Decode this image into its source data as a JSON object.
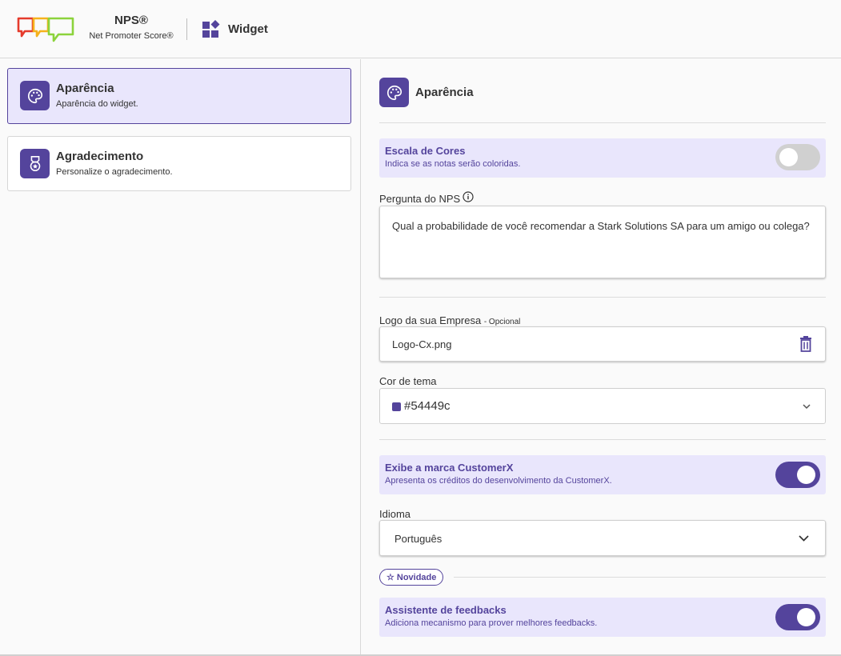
{
  "header": {
    "brand_title": "NPS®",
    "brand_subtitle": "Net Promoter Score®",
    "section_label": "Widget"
  },
  "sidebar": {
    "items": [
      {
        "title": "Aparência",
        "subtitle": "Aparência do widget.",
        "icon": "palette-icon",
        "active": true
      },
      {
        "title": "Agradecimento",
        "subtitle": "Personalize o agradecimento.",
        "icon": "medal-icon",
        "active": false
      }
    ]
  },
  "main": {
    "section_title": "Aparência",
    "color_scale": {
      "title": "Escala de Cores",
      "subtitle": "Indica se as notas serão coloridas.",
      "enabled": false
    },
    "question": {
      "label": "Pergunta do NPS",
      "value": "Qual a probabilidade de você recomendar a Stark Solutions SA para um amigo ou colega?"
    },
    "logo": {
      "label": "Logo da sua Empresa",
      "optional": "- Opcional",
      "value": "Logo-Cx.png"
    },
    "theme_color": {
      "label": "Cor de tema",
      "value": "#54449c"
    },
    "branding": {
      "title": "Exibe a marca CustomerX",
      "subtitle": "Apresenta os créditos do desenvolvimento da CustomerX.",
      "enabled": true
    },
    "language": {
      "label": "Idioma",
      "value": "Português"
    },
    "badge": {
      "label": "Novidade"
    },
    "assistant": {
      "title": "Assistente de feedbacks",
      "subtitle": "Adiciona mecanismo para prover melhores feedbacks.",
      "enabled": true
    }
  },
  "colors": {
    "accent": "#54449c",
    "accent_light": "#e9e6fc",
    "logo_red": "#e53b2c",
    "logo_yellow": "#f5b21c",
    "logo_green": "#8cd33c"
  }
}
